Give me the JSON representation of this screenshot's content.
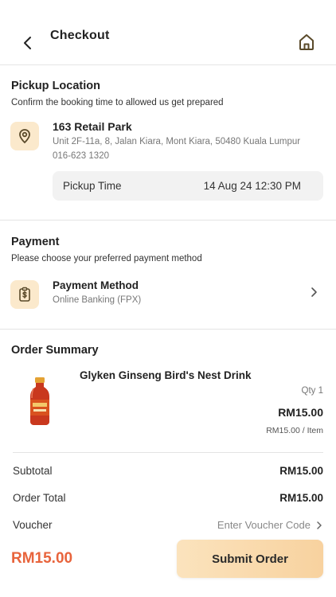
{
  "header": {
    "title": "Checkout",
    "back_icon": "chevron-left-icon",
    "home_icon": "home-icon"
  },
  "pickup": {
    "title": "Pickup Location",
    "subtitle": "Confirm the booking time to allowed us get prepared",
    "icon": "location-pin-icon",
    "location_name": "163 Retail Park",
    "address": "Unit 2F-11a, 8, Jalan Kiara, Mont Kiara, 50480 Kuala Lumpur",
    "phone": "016-623 1320",
    "time_label": "Pickup Time",
    "time_value": "14 Aug 24 12:30 PM"
  },
  "payment": {
    "title": "Payment",
    "subtitle": "Please choose your preferred payment method",
    "icon": "receipt-dollar-icon",
    "method_label": "Payment Method",
    "method_value": "Online Banking (FPX)"
  },
  "order": {
    "title": "Order Summary",
    "items": [
      {
        "name": "Glyken Ginseng Bird's Nest Drink",
        "qty": "Qty 1",
        "price": "RM15.00",
        "unit_price": "RM15.00 / Item"
      }
    ],
    "subtotal_label": "Subtotal",
    "subtotal_value": "RM15.00",
    "total_label": "Order Total",
    "total_value": "RM15.00",
    "voucher_label": "Voucher",
    "voucher_placeholder": "Enter Voucher Code"
  },
  "footer": {
    "total": "RM15.00",
    "submit_label": "Submit Order"
  },
  "colors": {
    "accent": "#e8643c",
    "badge_bg": "#fbe9cc",
    "button_gradient_start": "#fbe3bd",
    "button_gradient_end": "#f8d29f",
    "icon_stroke": "#5a4a2a"
  }
}
